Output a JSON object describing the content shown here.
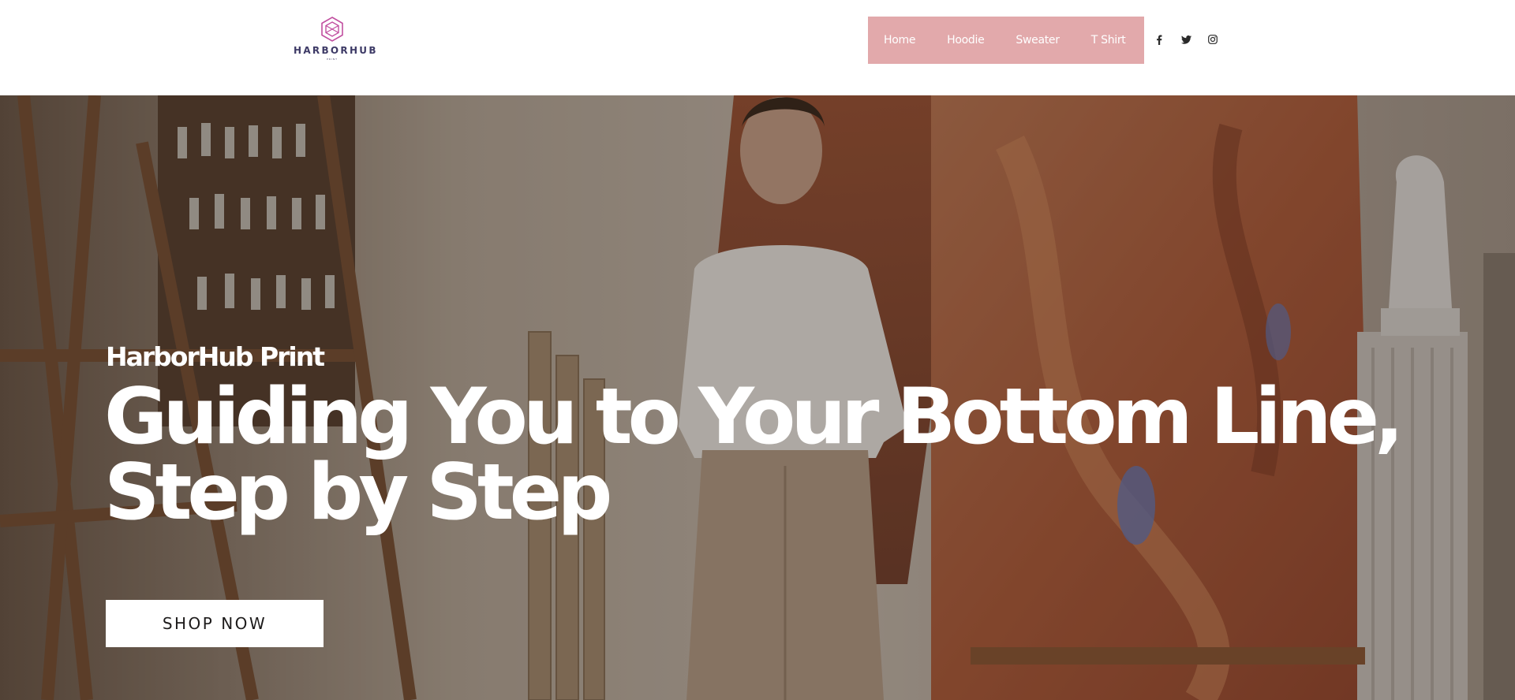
{
  "brand": {
    "name": "HARBORHUB",
    "tagline": "PRINT",
    "logo_color": "#c14fa0"
  },
  "nav": {
    "background": "#e2a9ab",
    "items": [
      {
        "label": "Home"
      },
      {
        "label": "Hoodie"
      },
      {
        "label": "Sweater"
      },
      {
        "label": "T Shirt"
      }
    ]
  },
  "socials": [
    {
      "icon": "facebook-icon"
    },
    {
      "icon": "twitter-icon"
    },
    {
      "icon": "instagram-icon"
    }
  ],
  "hero": {
    "eyebrow": "HarborHub Print",
    "headline": "Guiding You to Your Bottom Line, Step by Step",
    "cta_label": "SHOP NOW",
    "background_image": "artist-studio-photo"
  }
}
